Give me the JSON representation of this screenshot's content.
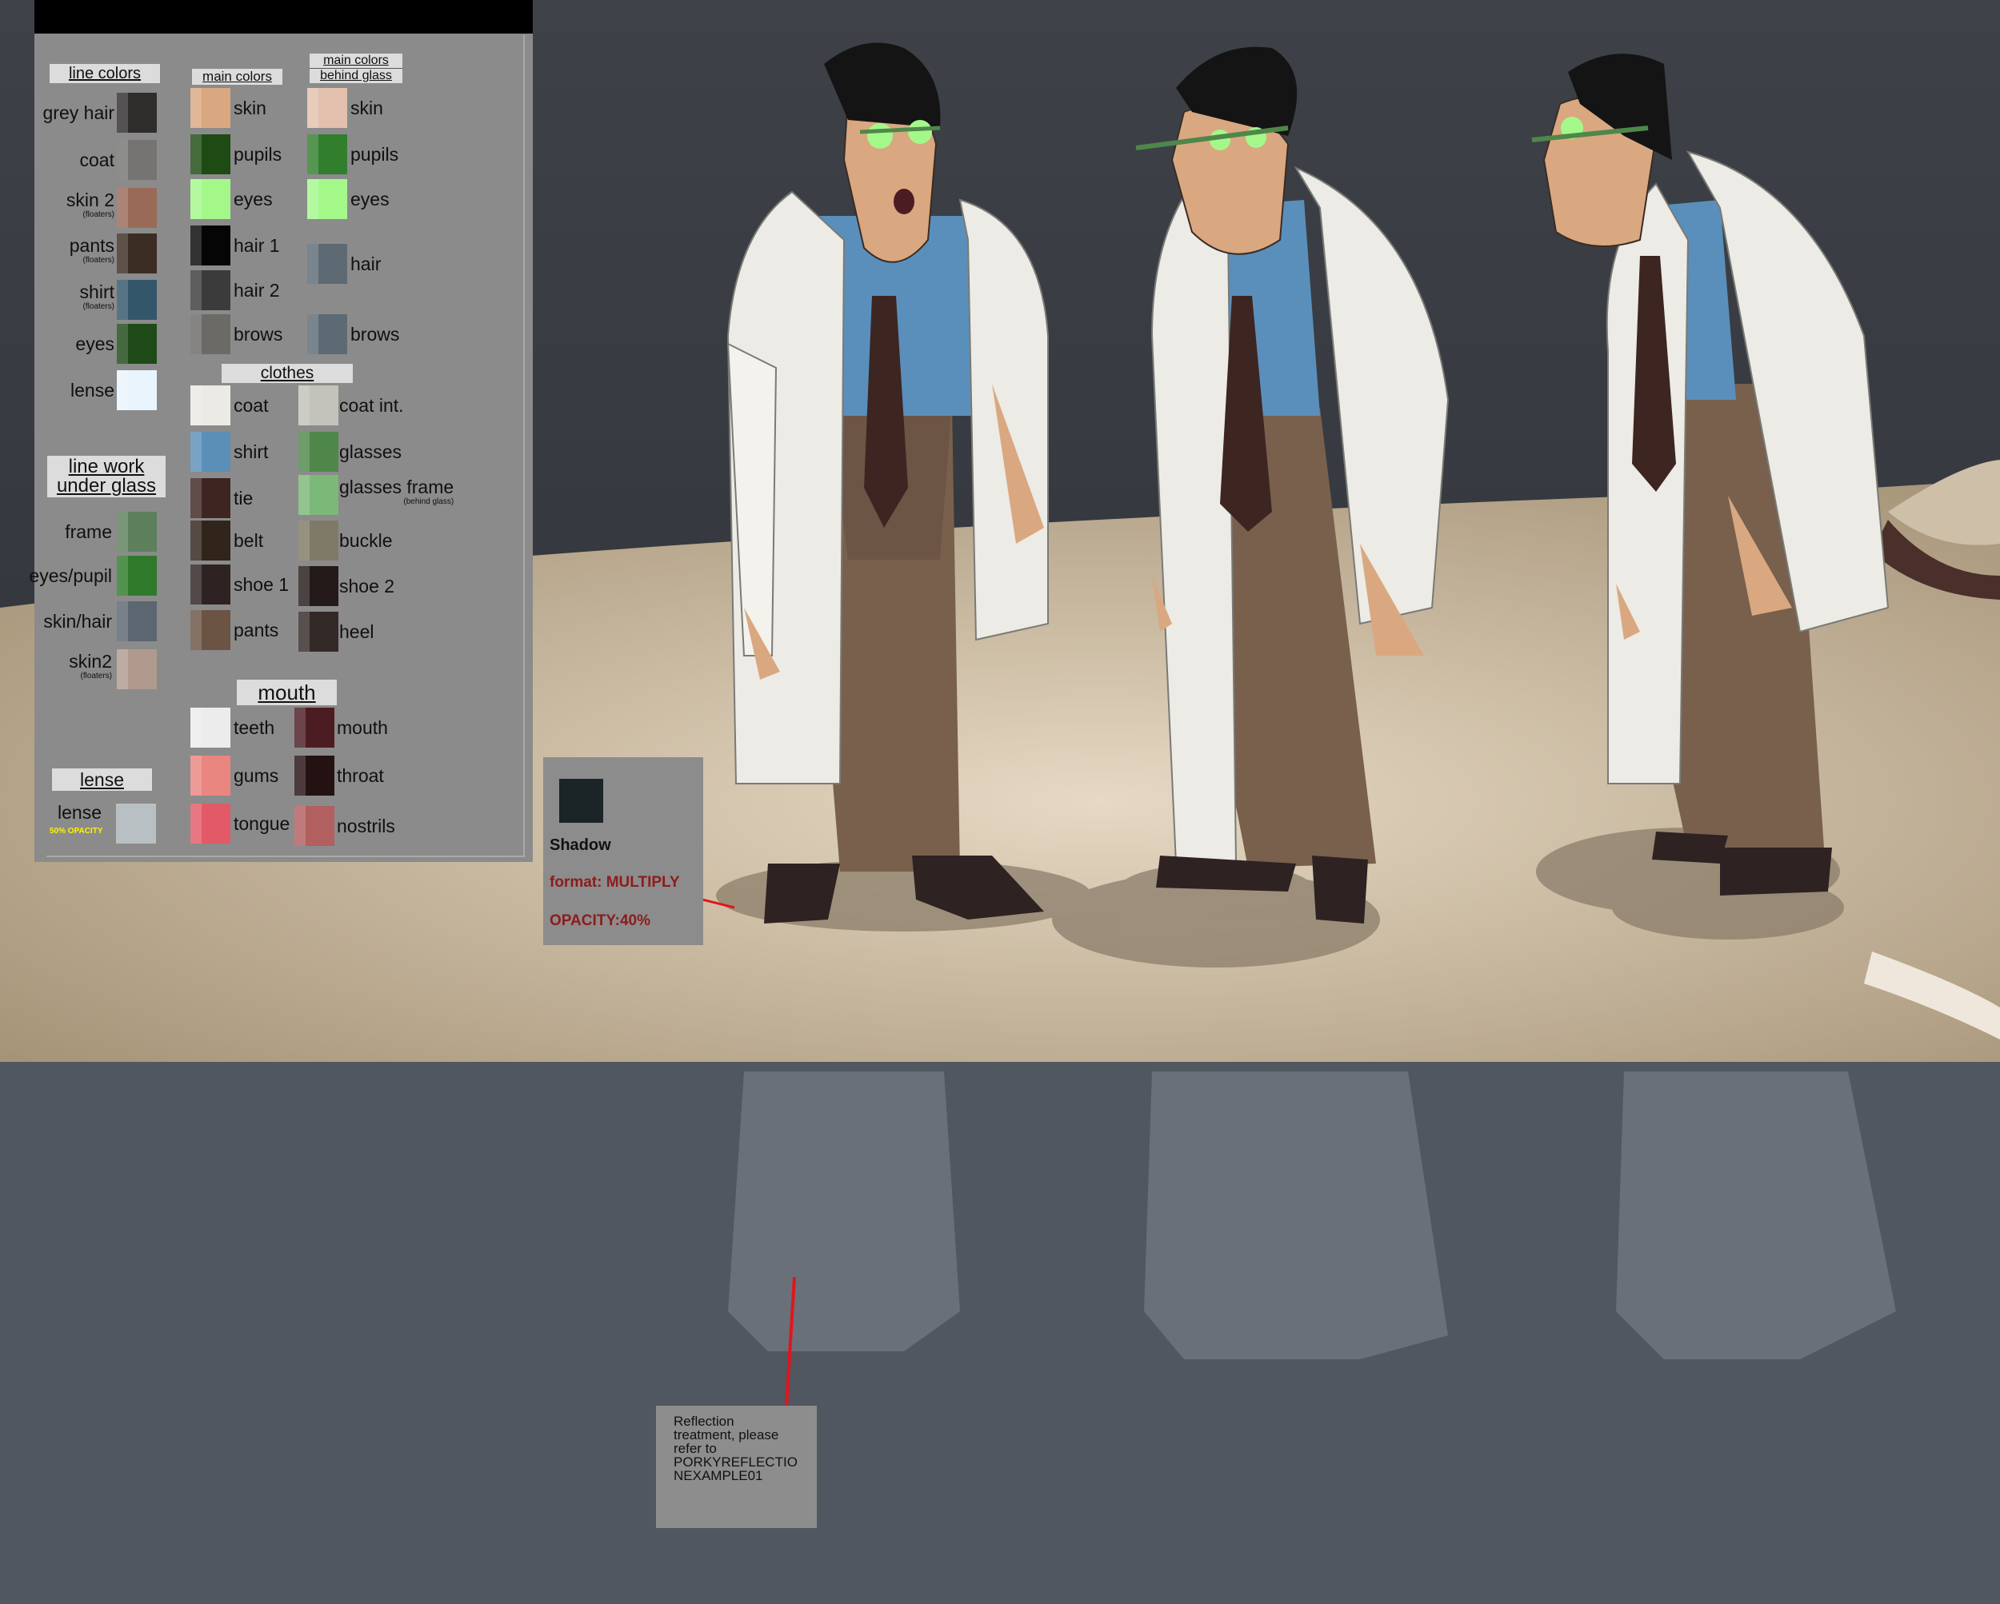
{
  "panel": {
    "line_colors": {
      "header": "line colors",
      "items": [
        {
          "label": "grey hair",
          "note": "",
          "color": "#2f2d2c"
        },
        {
          "label": "coat",
          "note": "",
          "color": "#757473"
        },
        {
          "label": "skin 2",
          "note": "(floaters)",
          "color": "#9a6a58"
        },
        {
          "label": "pants",
          "note": "(floaters)",
          "color": "#3b2c24"
        },
        {
          "label": "shirt",
          "note": "(floaters)",
          "color": "#33566b"
        },
        {
          "label": "eyes",
          "note": "",
          "color": "#1d4a16"
        },
        {
          "label": "lense",
          "note": "",
          "color": "#eaf4fd"
        }
      ]
    },
    "line_work": {
      "header_line1": "line work",
      "header_line2": "under glass",
      "items": [
        {
          "label": "frame",
          "note": "",
          "color": "#5d7f5c"
        },
        {
          "label": "eyes/pupil",
          "note": "",
          "color": "#2f7a2a"
        },
        {
          "label": "skin/hair",
          "note": "",
          "color": "#5b6670"
        },
        {
          "label": "skin2",
          "note": "(floaters)",
          "color": "#b09a8e"
        }
      ]
    },
    "lense_group": {
      "header": "lense",
      "label": "lense",
      "note": "50% OPACITY",
      "color": "#b9c0c4"
    },
    "main_colors": {
      "header": "main colors",
      "items": [
        {
          "label": "skin",
          "color": "#d9a880"
        },
        {
          "label": "pupils",
          "color": "#1d4b13"
        },
        {
          "label": "eyes",
          "color": "#a4f88a"
        },
        {
          "label": "hair 1",
          "color": "#050505"
        },
        {
          "label": "hair 2",
          "color": "#3b3b3b"
        },
        {
          "label": "brows",
          "color": "#6b6a67"
        }
      ]
    },
    "behind_glass": {
      "header_line1": "main colors",
      "header_line2": "behind glass",
      "items": [
        {
          "label": "skin",
          "color": "#e2c0ad"
        },
        {
          "label": "pupils",
          "color": "#317f2c"
        },
        {
          "label": "eyes",
          "color": "#a4f88a"
        },
        {
          "label": "hair",
          "color": "#5d6a74"
        },
        {
          "label": "brows",
          "color": "#5d6a74"
        }
      ]
    },
    "clothes": {
      "header": "clothes",
      "left": [
        {
          "label": "coat",
          "note": "",
          "color": "#eceae4"
        },
        {
          "label": "shirt",
          "note": "",
          "color": "#5b8fb8"
        },
        {
          "label": "tie",
          "note": "",
          "color": "#3d2522"
        },
        {
          "label": "belt",
          "note": "",
          "color": "#30241b"
        },
        {
          "label": "shoe 1",
          "note": "",
          "color": "#2e2222"
        },
        {
          "label": "pants",
          "note": "",
          "color": "#6b5444"
        }
      ],
      "right": [
        {
          "label": "coat int.",
          "note": "",
          "color": "#c3c3bb"
        },
        {
          "label": "glasses",
          "note": "",
          "color": "#4f874a"
        },
        {
          "label": "glasses frame",
          "note": "(behind glass)",
          "color": "#7cb877"
        },
        {
          "label": "buckle",
          "note": "",
          "color": "#7f7a67"
        },
        {
          "label": "shoe 2",
          "note": "",
          "color": "#241a19"
        },
        {
          "label": "heel",
          "note": "",
          "color": "#332a28"
        }
      ]
    },
    "mouth": {
      "header": "mouth",
      "left": [
        {
          "label": "teeth",
          "color": "#ececec"
        },
        {
          "label": "gums",
          "color": "#e98680"
        },
        {
          "label": "tongue",
          "color": "#e25967"
        }
      ],
      "right": [
        {
          "label": "mouth",
          "color": "#4b1d22"
        },
        {
          "label": "throat",
          "color": "#241112"
        },
        {
          "label": "nostrils",
          "color": "#b15f5f"
        }
      ]
    }
  },
  "shadow_note": {
    "title": "Shadow",
    "format": "format: MULTIPLY",
    "opacity": "OPACITY:40%",
    "color": "#1b2426"
  },
  "reflection_note": {
    "text": "Reflection\ntreatment, please\nrefer to\nPORKYREFLECTIO\nNEXAMPLE01"
  },
  "colors": {
    "wall": "#3b3f45",
    "floor": "#c3b197",
    "panel_bg": "#8b8b8b",
    "leader_line": "#e0161c"
  }
}
